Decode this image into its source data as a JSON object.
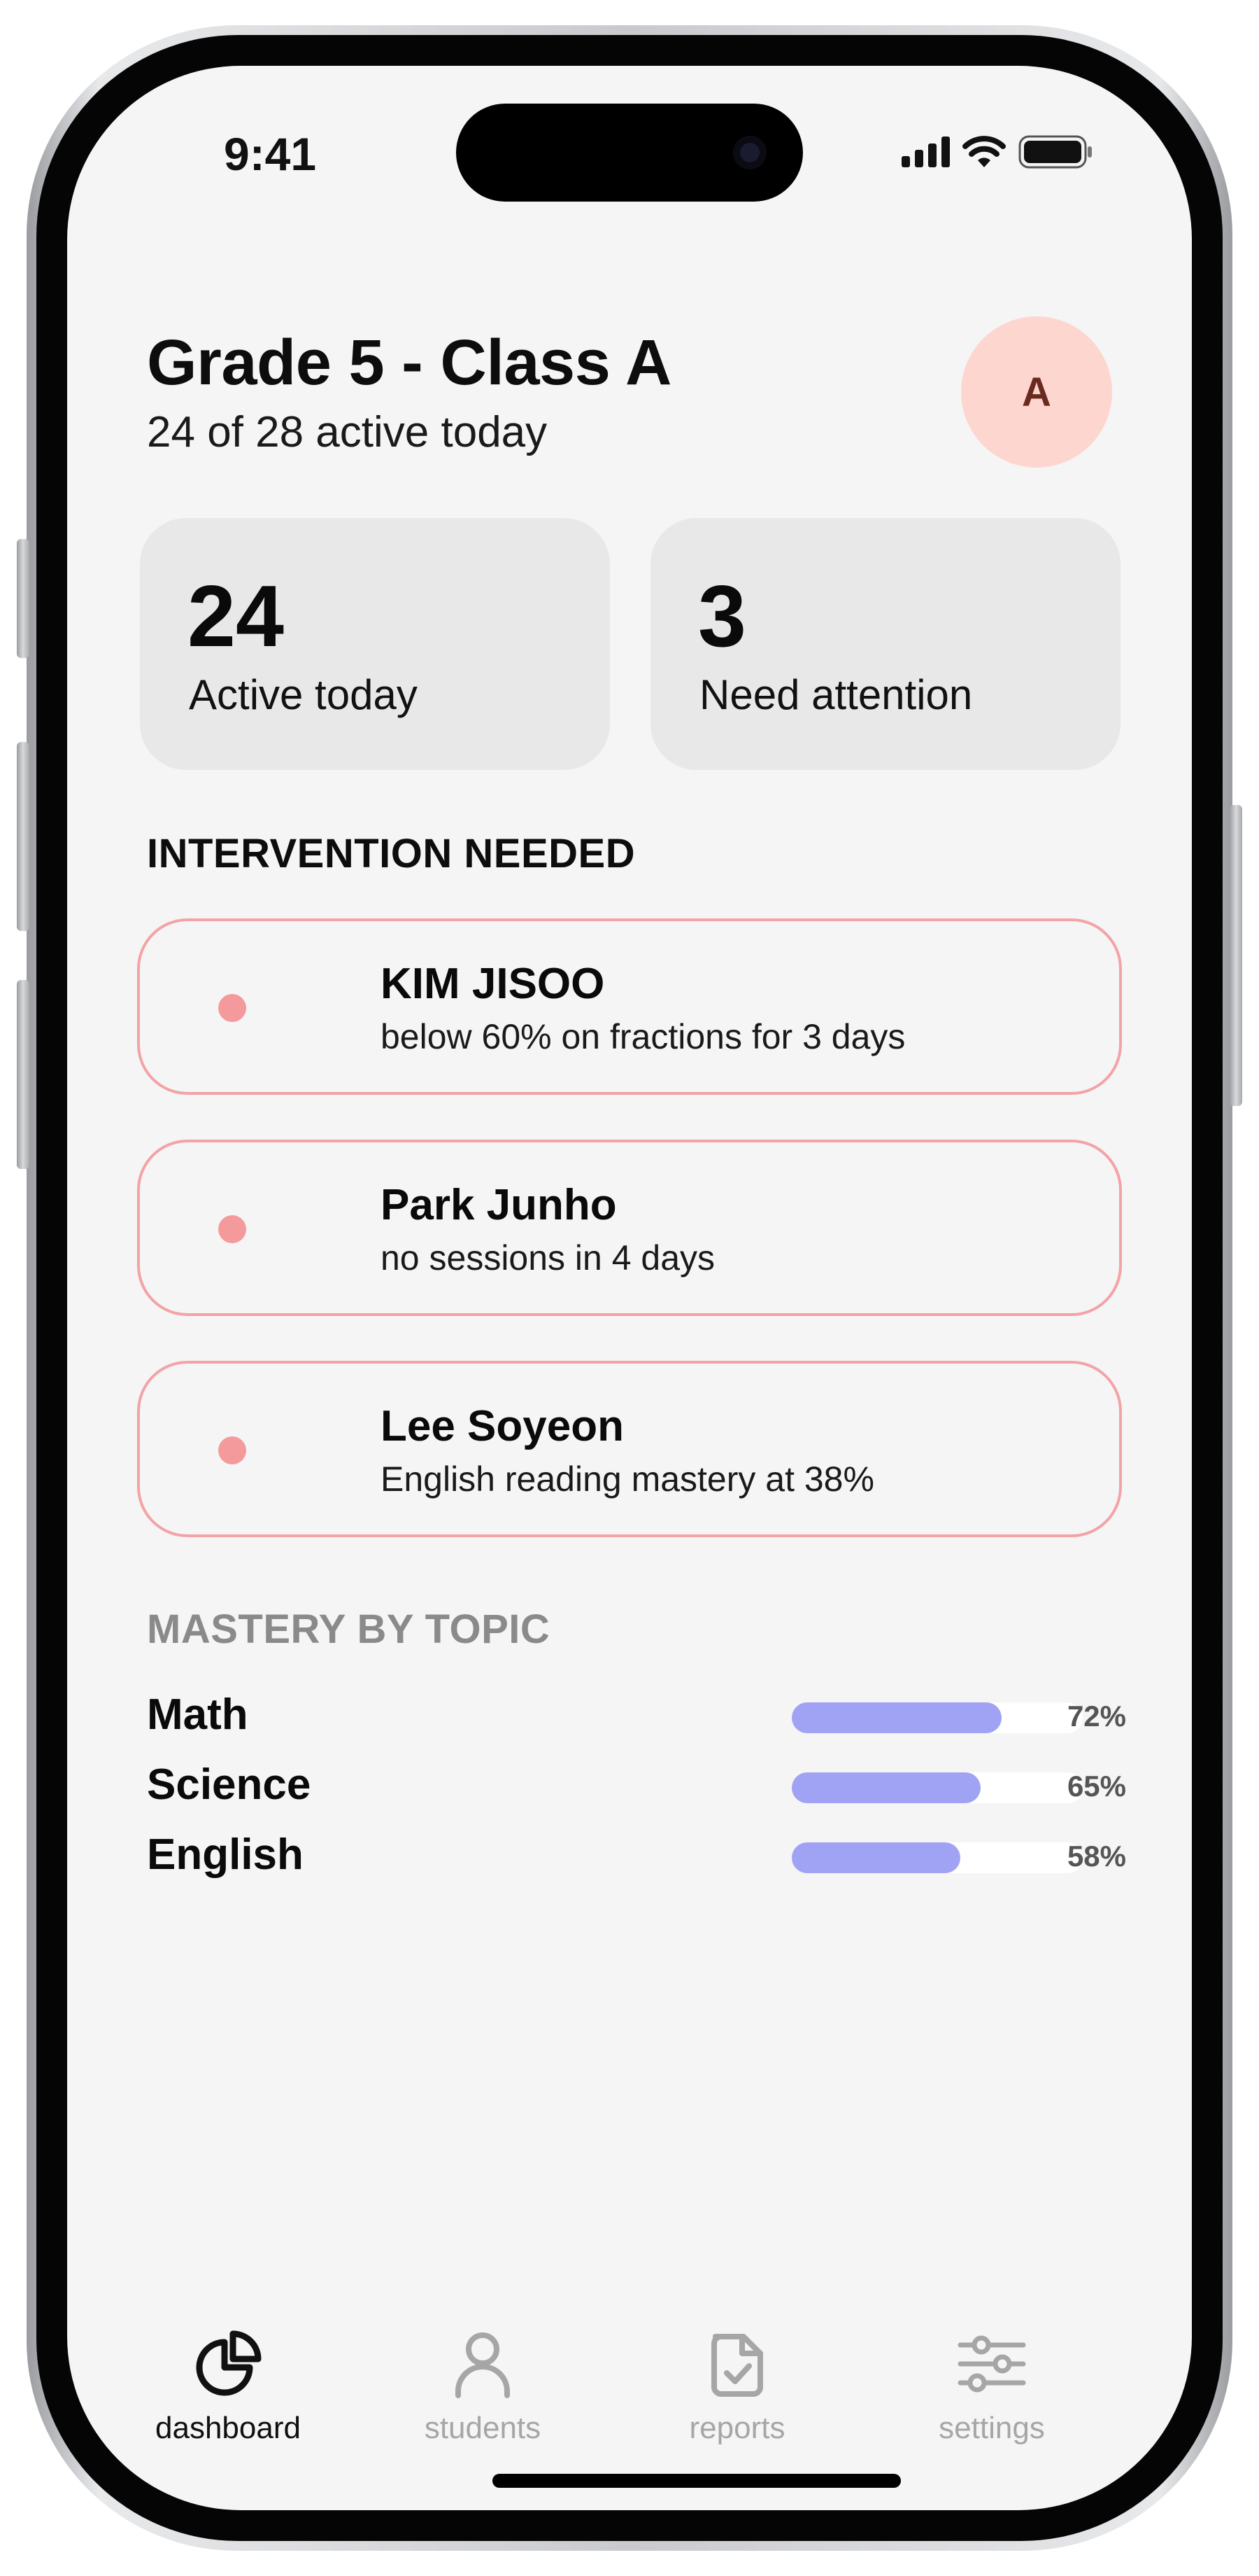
{
  "status_bar": {
    "time": "9:41",
    "icons": [
      "cellular-signal-icon",
      "wifi-icon",
      "battery-icon"
    ]
  },
  "header": {
    "title": "Grade 5 - Class A",
    "subtitle": "24 of 28 active today",
    "avatar_initial": "A"
  },
  "stats": [
    {
      "value": "24",
      "label": "Active today"
    },
    {
      "value": "3",
      "label": "Need attention"
    }
  ],
  "intervention": {
    "heading": "INTERVENTION NEEDED",
    "students": [
      {
        "name": "KIM JISOO",
        "detail": "below 60% on fractions for 3 days"
      },
      {
        "name": "Park Junho",
        "detail": "no sessions in 4 days"
      },
      {
        "name": "Lee Soyeon",
        "detail": "English reading mastery at 38%"
      }
    ]
  },
  "mastery": {
    "heading": "MASTERY BY TOPIC",
    "topics": [
      {
        "name": "Math",
        "percent_label": "72%",
        "value": 0.72
      },
      {
        "name": "Science",
        "percent_label": "65%",
        "value": 0.65
      },
      {
        "name": "English",
        "percent_label": "58%",
        "value": 0.58
      }
    ]
  },
  "nav": {
    "items": [
      {
        "label": "dashboard",
        "icon": "pie-chart-icon",
        "active": true
      },
      {
        "label": "students",
        "icon": "person-icon",
        "active": false
      },
      {
        "label": "reports",
        "icon": "document-check-icon",
        "active": false
      },
      {
        "label": "settings",
        "icon": "sliders-icon",
        "active": false
      }
    ]
  },
  "colors": {
    "accent": "#a0a3f3",
    "alert_border": "#f3a3a6",
    "alert_dot": "#f59a9c",
    "avatar_bg": "#fdd6d0",
    "avatar_text": "#6b2a1f",
    "nav_active": "#111111",
    "nav_inactive": "#a6a6a6"
  }
}
